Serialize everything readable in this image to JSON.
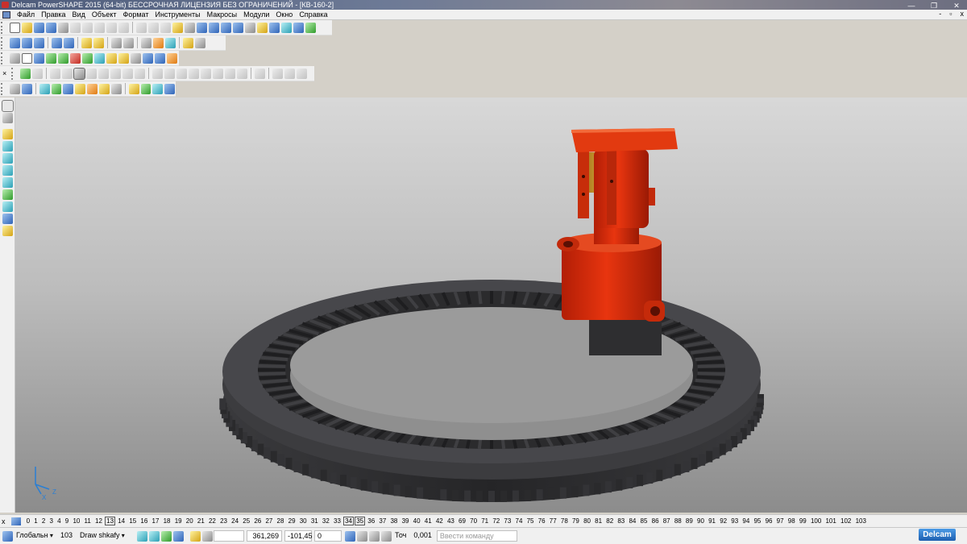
{
  "window": {
    "title": "Delcam PowerSHAPE 2015 (64-bit) БЕССРОЧНАЯ ЛИЦЕНЗИЯ БЕЗ ОГРАНИЧЕНИЙ - [КВ-160-2]",
    "min_glyph": "—",
    "max_glyph": "❐",
    "close_glyph": "✕"
  },
  "menu": {
    "items": [
      "Файл",
      "Правка",
      "Вид",
      "Объект",
      "Формат",
      "Инструменты",
      "Макросы",
      "Модули",
      "Окно",
      "Справка"
    ],
    "mdi_min": "-",
    "mdi_restore": "▫",
    "mdi_close": "x"
  },
  "levels": {
    "close": "x",
    "numbers": [
      "0",
      "1",
      "2",
      "3",
      "4",
      "9",
      "10",
      "11",
      "12",
      "13",
      "14",
      "15",
      "16",
      "17",
      "18",
      "19",
      "20",
      "21",
      "22",
      "23",
      "24",
      "25",
      "26",
      "27",
      "28",
      "29",
      "30",
      "31",
      "32",
      "33",
      "34",
      "35",
      "36",
      "37",
      "38",
      "39",
      "40",
      "41",
      "42",
      "43",
      "69",
      "70",
      "71",
      "72",
      "73",
      "74",
      "75",
      "76",
      "77",
      "78",
      "79",
      "80",
      "81",
      "82",
      "83",
      "84",
      "85",
      "86",
      "87",
      "88",
      "89",
      "90",
      "91",
      "92",
      "93",
      "94",
      "95",
      "96",
      "97",
      "98",
      "99",
      "100",
      "101",
      "102",
      "103"
    ],
    "active": [
      "13",
      "34",
      "35"
    ]
  },
  "status": {
    "workplane": "Глобальн",
    "level_number": "103",
    "level_name": "Draw shkafy",
    "x_coord": "361,269",
    "y_coord": "-101,45",
    "z_coord": "0",
    "tolerance_label": "Точ",
    "tolerance_value": "0,001",
    "command_placeholder": "Ввести команду",
    "logo": "Delcam"
  },
  "viewport": {
    "axis_x": "X",
    "axis_z": "Z",
    "colors": {
      "ring": "#2e2e30",
      "ring_light": "#4a4a4d",
      "motor": "#d42a0c",
      "motor_dark": "#9a1a05",
      "brass": "#d9a02a"
    }
  }
}
